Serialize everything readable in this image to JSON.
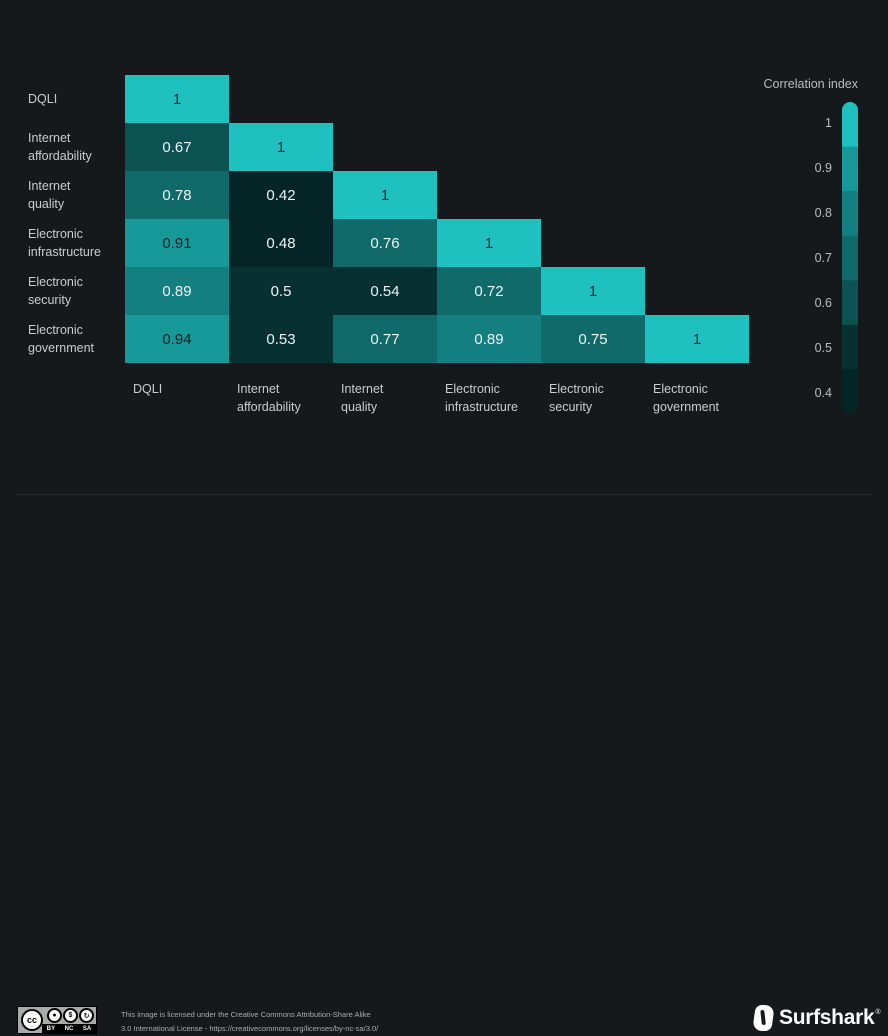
{
  "chart_data": {
    "type": "heatmap",
    "title": "",
    "variables": [
      "DQLI",
      "Internet affordability",
      "Internet quality",
      "Electronic infrastructure",
      "Electronic security",
      "Electronic government"
    ],
    "row_labels": [
      [
        "DQLI"
      ],
      [
        "Internet",
        "affordability"
      ],
      [
        "Internet",
        "quality"
      ],
      [
        "Electronic",
        "infrastructure"
      ],
      [
        "Electronic",
        "security"
      ],
      [
        "Electronic",
        "government"
      ]
    ],
    "col_labels": [
      [
        "DQLI"
      ],
      [
        "Internet",
        "affordability"
      ],
      [
        "Internet",
        "quality"
      ],
      [
        "Electronic",
        "infrastructure"
      ],
      [
        "Electronic",
        "security"
      ],
      [
        "Electronic",
        "government"
      ]
    ],
    "matrix": [
      [
        1
      ],
      [
        0.67,
        1
      ],
      [
        0.78,
        0.42,
        1
      ],
      [
        0.91,
        0.48,
        0.76,
        1
      ],
      [
        0.89,
        0.5,
        0.54,
        0.72,
        1
      ],
      [
        0.94,
        0.53,
        0.77,
        0.89,
        0.75,
        1
      ]
    ],
    "layout": "lower-triangle",
    "legend": {
      "title": "Correlation index",
      "position": "right",
      "ticks": [
        "1",
        "0.9",
        "0.8",
        "0.7",
        "0.6",
        "0.5",
        "0.4"
      ],
      "range": [
        0.4,
        1
      ]
    },
    "color_bins": [
      {
        "min": 1.0,
        "color": "#1ec1c0"
      },
      {
        "min": 0.9,
        "color": "#17999a"
      },
      {
        "min": 0.8,
        "color": "#147f80"
      },
      {
        "min": 0.7,
        "color": "#116a6a"
      },
      {
        "min": 0.6,
        "color": "#0d5252"
      },
      {
        "min": 0.5,
        "color": "#073031"
      },
      {
        "min": 0.4,
        "color": "#052426"
      }
    ],
    "dark_text_threshold": 0.9
  },
  "footer": {
    "cc_badge": {
      "cc": "cc",
      "labels": [
        "BY",
        "NC",
        "SA"
      ]
    },
    "license_line1": "This image is licensed under the Creative Commons Attribution-Share Alike",
    "license_line2": "3.0 International License - https://creativecommons.org/licenses/by-nc-sa/3.0/",
    "brand_name": "Surfshark",
    "brand_mark": "®"
  }
}
